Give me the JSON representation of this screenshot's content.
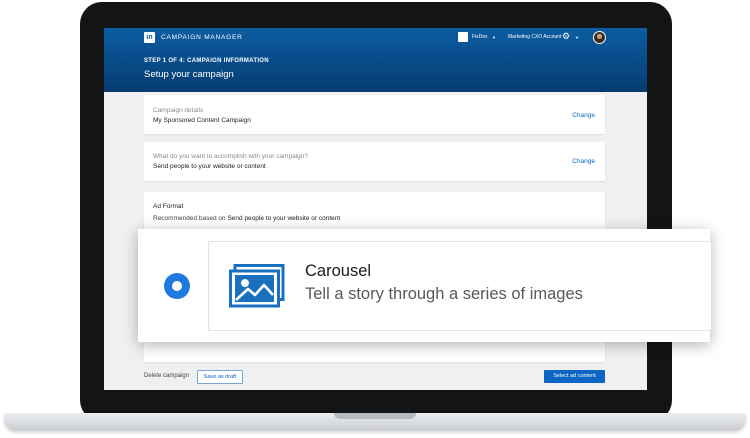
{
  "header": {
    "logo": "in",
    "brand": "CAMPAIGN MANAGER",
    "account1": "FixDex",
    "account2": "Marketing CXO Account"
  },
  "page": {
    "step": "STEP 1 OF 4: CAMPAIGN INFORMATION",
    "title": "Setup your campaign"
  },
  "campaign_details": {
    "label": "Campaign details",
    "value": "My Sponsored Content Campaign",
    "action": "Change"
  },
  "objective": {
    "label": "What do you want to accomplish with your campaign?",
    "value": "Send people to your website or content",
    "action": "Change"
  },
  "ad_format": {
    "title": "Ad Format",
    "recommended_prefix": "Recommended based on",
    "recommended_value": "Send people to your website or content",
    "option": {
      "title": "Carousel",
      "description": "Tell a story through a series of images",
      "icon": "image-gallery-icon",
      "selected": true
    }
  },
  "footer": {
    "delete": "Delete campaign",
    "save_draft": "Save as draft",
    "next": "Select ad content"
  },
  "colors": {
    "header_top": "#0c5da3",
    "header_bottom": "#063c70",
    "accent": "#0a66c2",
    "radio": "#1f7ae0",
    "icon": "#1a6fbf"
  }
}
